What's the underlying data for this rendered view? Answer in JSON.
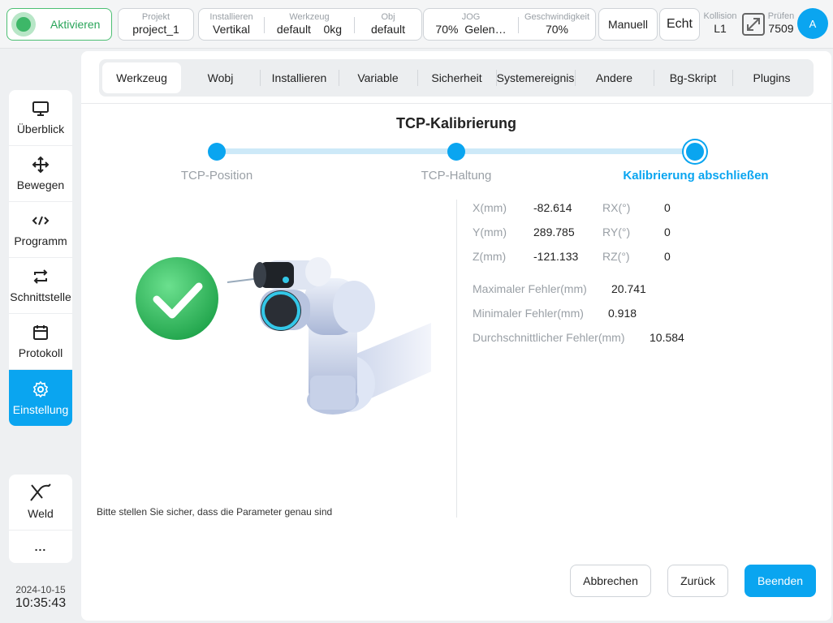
{
  "topbar": {
    "activate_label": "Aktivieren",
    "project": {
      "caption": "Projekt",
      "value": "project_1"
    },
    "install": {
      "caption": "Installieren",
      "value": "Vertikal"
    },
    "tool": {
      "caption": "Werkzeug",
      "value": "default",
      "load": "0kg"
    },
    "obj": {
      "caption": "Obj",
      "value": "default"
    },
    "jog": {
      "caption": "JOG",
      "percent": "70%",
      "mode": "Gelen…"
    },
    "speed": {
      "caption": "Geschwindigkeit",
      "value": "70%"
    },
    "mode_button": "Manuell",
    "real_button": "Echt",
    "collision": {
      "caption": "Kollision",
      "value": "L1"
    },
    "check": {
      "caption": "Prüfen",
      "value": "7509"
    },
    "avatar": "A"
  },
  "sidebar": {
    "items": [
      {
        "label": "Überblick",
        "icon": "monitor-icon"
      },
      {
        "label": "Bewegen",
        "icon": "move-arrows-icon"
      },
      {
        "label": "Programm",
        "icon": "code-icon"
      },
      {
        "label": "Schnittstelle",
        "icon": "swap-arrows-icon"
      },
      {
        "label": "Protokoll",
        "icon": "calendar-icon"
      },
      {
        "label": "Einstellung",
        "icon": "gear-icon",
        "active": true
      }
    ],
    "extra": [
      {
        "label": "Weld",
        "icon": "weld-torch-icon"
      },
      {
        "label": "...",
        "icon": "more-icon"
      }
    ],
    "date": "2024-10-15",
    "time": "10:35:43"
  },
  "tabs": [
    "Werkzeug",
    "Wobj",
    "Installieren",
    "Variable",
    "Sicherheit",
    "Systemereignis",
    "Andere",
    "Bg-Skript",
    "Plugins"
  ],
  "active_tab": "Werkzeug",
  "wizard": {
    "title": "TCP-Kalibrierung",
    "steps": [
      "TCP-Position",
      "TCP-Haltung",
      "Kalibrierung abschließen"
    ],
    "current_step": 3
  },
  "results": {
    "x": {
      "label": "X(mm)",
      "value": "-82.614"
    },
    "y": {
      "label": "Y(mm)",
      "value": "289.785"
    },
    "z": {
      "label": "Z(mm)",
      "value": "-121.133"
    },
    "rx": {
      "label": "RX(°)",
      "value": "0"
    },
    "ry": {
      "label": "RY(°)",
      "value": "0"
    },
    "rz": {
      "label": "RZ(°)",
      "value": "0"
    },
    "max_err": {
      "label": "Maximaler Fehler(mm)",
      "value": "20.741"
    },
    "min_err": {
      "label": "Minimaler Fehler(mm)",
      "value": "0.918"
    },
    "avg_err": {
      "label": "Durchschnittlicher Fehler(mm)",
      "value": "10.584"
    }
  },
  "note": "Bitte stellen Sie sicher, dass die Parameter genau sind",
  "buttons": {
    "cancel": "Abbrechen",
    "back": "Zurück",
    "finish": "Beenden"
  },
  "colors": {
    "accent": "#0aa5f0",
    "success": "#3db768",
    "track": "#cde9f8"
  }
}
